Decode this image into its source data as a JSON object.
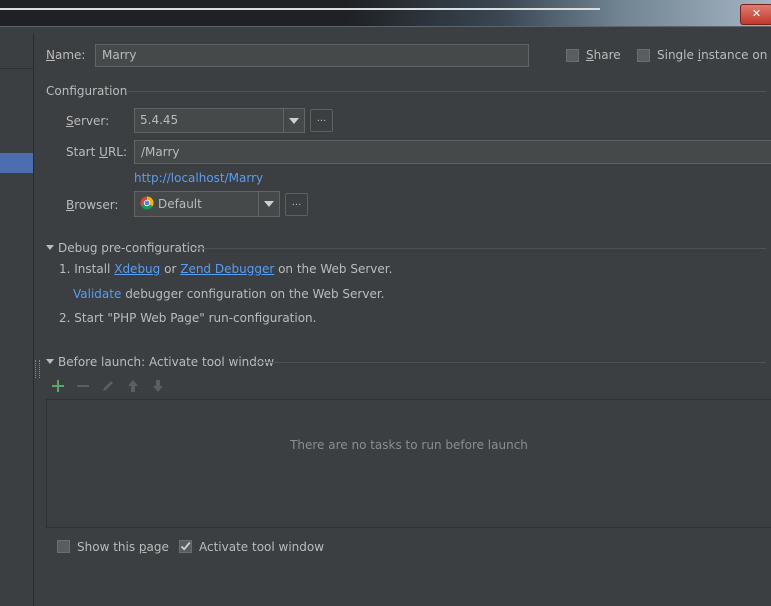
{
  "name": {
    "label": "Name:",
    "value": "Marry"
  },
  "share": {
    "label": "Share",
    "checked": false
  },
  "single_instance": {
    "label": "Single instance on",
    "checked": false
  },
  "configuration": {
    "title": "Configuration",
    "server": {
      "label": "Server:",
      "value": "5.4.45",
      "more": "..."
    },
    "start_url": {
      "label": "Start URL:",
      "value": "/Marry",
      "link": "http://localhost/Marry"
    },
    "browser": {
      "label": "Browser:",
      "value": "Default",
      "icon": "chrome-icon",
      "more": "..."
    }
  },
  "debug_preconfig": {
    "title": "Debug pre-configuration",
    "step1_prefix": "1. Install",
    "xdebug": "Xdebug",
    "or": "or",
    "zend": "Zend Debugger",
    "step1_suffix": "on the Web Server.",
    "validate": "Validate",
    "validate_suffix": "debugger configuration on the Web Server.",
    "step2": "2. Start \"PHP Web Page\" run-configuration."
  },
  "before_launch": {
    "title": "Before launch: Activate tool window",
    "toolbar": [
      "add-icon",
      "remove-icon",
      "edit-icon",
      "move-up-icon",
      "move-down-icon"
    ],
    "empty_text": "There are no tasks to run before launch"
  },
  "show_this_page": {
    "label": "Show this page",
    "checked": false
  },
  "activate_tool_window": {
    "label": "Activate tool window",
    "checked": true
  },
  "colors": {
    "background": "#3c3f41",
    "link": "#589df6",
    "selection": "#4b6eaf",
    "add": "#59a869"
  }
}
